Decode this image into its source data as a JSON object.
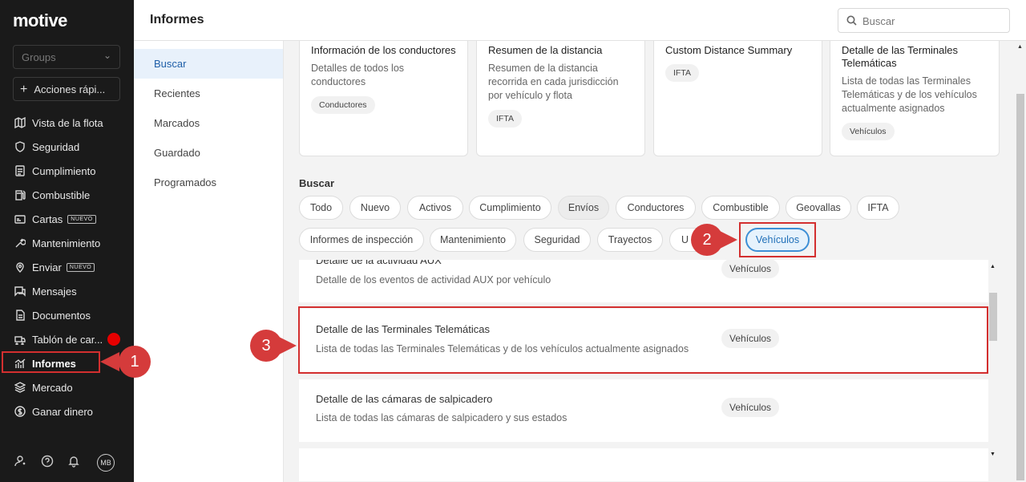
{
  "brand": "motive",
  "sidebar": {
    "groups_placeholder": "Groups",
    "quick_actions": "Acciones rápi...",
    "items": [
      {
        "label": "Vista de la flota",
        "icon": "map-icon"
      },
      {
        "label": "Seguridad",
        "icon": "shield-icon"
      },
      {
        "label": "Cumplimiento",
        "icon": "document-icon"
      },
      {
        "label": "Combustible",
        "icon": "fuel-icon"
      },
      {
        "label": "Cartas",
        "icon": "card-icon",
        "badge": "NUEVO"
      },
      {
        "label": "Mantenimiento",
        "icon": "wrench-icon"
      },
      {
        "label": "Enviar",
        "icon": "send-icon",
        "badge": "NUEVO"
      },
      {
        "label": "Mensajes",
        "icon": "chat-icon"
      },
      {
        "label": "Documentos",
        "icon": "file-icon"
      },
      {
        "label": "Tablón de car...",
        "icon": "board-icon"
      },
      {
        "label": "Informes",
        "icon": "chart-icon"
      },
      {
        "label": "Mercado",
        "icon": "layers-icon"
      },
      {
        "label": "Ganar dinero",
        "icon": "dollar-icon"
      }
    ],
    "avatar_initials": "MB"
  },
  "header": {
    "title": "Informes",
    "search_placeholder": "Buscar"
  },
  "subnav": [
    "Buscar",
    "Recientes",
    "Marcados",
    "Guardado",
    "Programados"
  ],
  "cards": [
    {
      "title": "Información de los conductores",
      "desc": "Detalles de todos los conductores",
      "chip": "Conductores"
    },
    {
      "title": "Resumen de la distancia",
      "desc": "Resumen de la distancia recorrida en cada jurisdicción por vehículo y flota",
      "chip": "IFTA"
    },
    {
      "title": "Custom Distance Summary",
      "desc": "",
      "chip": "IFTA"
    },
    {
      "title": "Detalle de las Terminales Telemáticas",
      "desc": "Lista de todas las Terminales Telemáticas y de los vehículos actualmente asignados",
      "chip": "Vehículos"
    }
  ],
  "buscar_label": "Buscar",
  "filters_row1": [
    "Todo",
    "Nuevo",
    "Activos",
    "Cumplimiento",
    "Envíos",
    "Conductores",
    "Combustible",
    "Geovallas",
    "IFTA"
  ],
  "filters_row2": [
    "Informes de inspección",
    "Mantenimiento",
    "Seguridad",
    "Trayectos",
    "U",
    "Vehículos"
  ],
  "list": [
    {
      "title": "Detalle de la actividad AUX",
      "desc": "Detalle de los eventos de actividad AUX por vehículo",
      "chip": "Vehículos"
    },
    {
      "title": "Detalle de las Terminales Telemáticas",
      "desc": "Lista de todas las Terminales Telemáticas y de los vehículos actualmente asignados",
      "chip": "Vehículos"
    },
    {
      "title": "Detalle de las cámaras de salpicadero",
      "desc": "Lista de todas las cámaras de salpicadero y sus estados",
      "chip": "Vehículos"
    }
  ],
  "annotations": {
    "step1": "1",
    "step2": "2",
    "step3": "3",
    "color": "#d32f2f"
  }
}
